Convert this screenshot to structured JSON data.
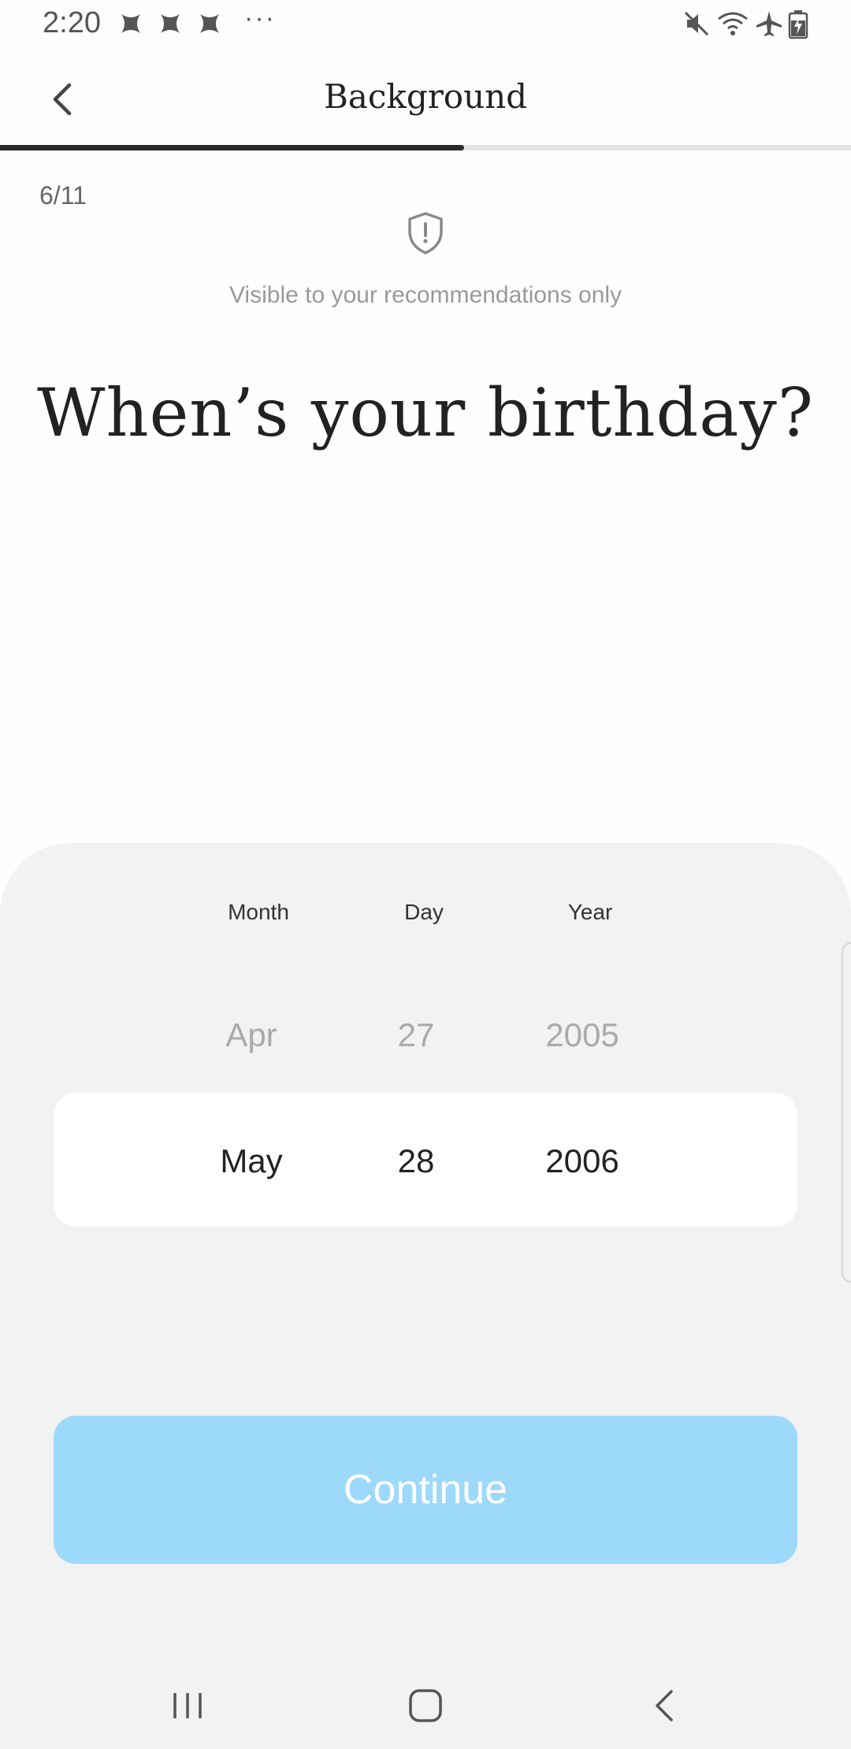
{
  "status_bar": {
    "time": "2:20",
    "overflow": "···",
    "notification_icons": [
      "app-notification-icon",
      "app-notification-icon",
      "app-notification-icon"
    ],
    "system_icons": [
      "mute-icon",
      "wifi-icon",
      "airplane-mode-icon",
      "battery-charging-icon"
    ]
  },
  "header": {
    "title": "Background",
    "back_icon": "chevron-left-icon",
    "progress_fraction": 0.545
  },
  "main": {
    "step_counter": "6/11",
    "privacy_icon": "shield-alert-icon",
    "privacy_note": "Visible to your recommendations only",
    "question": "When’s your birthday?"
  },
  "picker": {
    "labels": {
      "month": "Month",
      "day": "Day",
      "year": "Year"
    },
    "previous": {
      "month": "Apr",
      "day": "27",
      "year": "2005"
    },
    "selected": {
      "month": "May",
      "day": "28",
      "year": "2006"
    }
  },
  "actions": {
    "continue_label": "Continue",
    "continue_color": "#9dd9fb"
  },
  "nav_bar": {
    "icons": [
      "recent-apps-icon",
      "home-icon",
      "back-icon"
    ]
  }
}
